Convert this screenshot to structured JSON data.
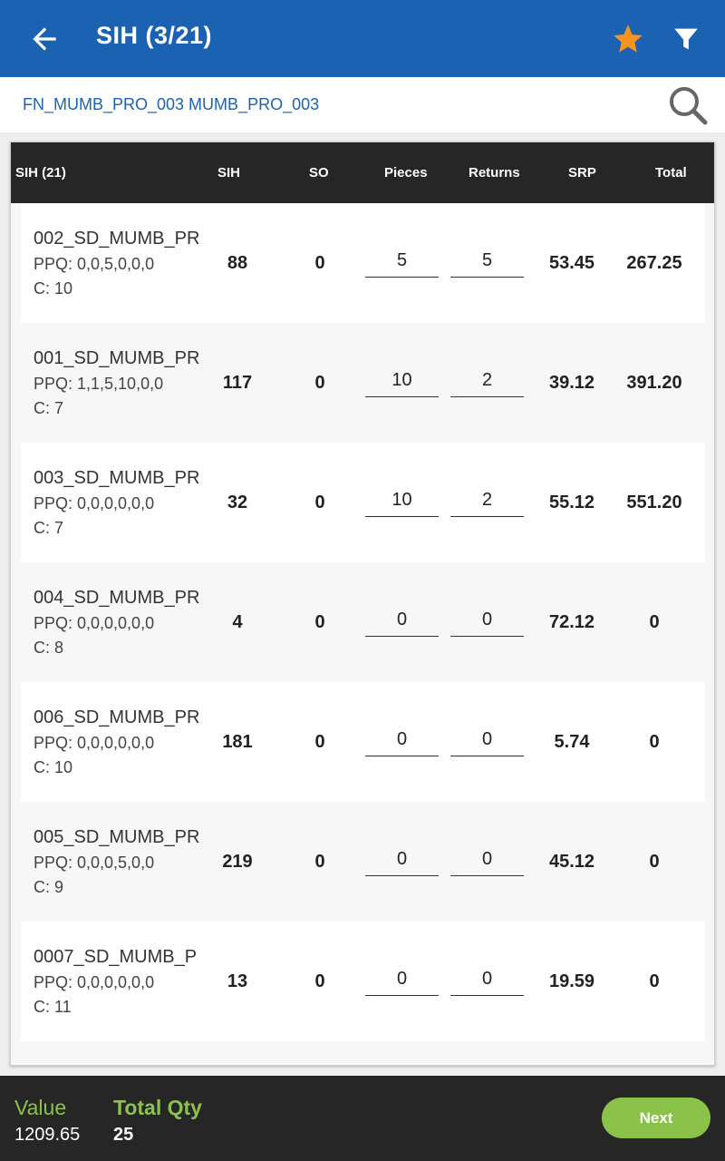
{
  "header": {
    "title": "SIH (3/21)",
    "back_icon": "back-arrow-icon",
    "star_icon": "star-icon",
    "filter_icon": "filter-icon",
    "star_color": "#f7931e",
    "bg_color": "#1b62b3"
  },
  "search": {
    "value": "FN_MUMB_PRO_003 MUMB_PRO_003",
    "icon": "search-icon"
  },
  "table": {
    "columns": [
      "SIH (21)",
      "SIH",
      "SO",
      "Pieces",
      "Returns",
      "SRP",
      "Total"
    ],
    "rows": [
      {
        "name": "002_SD_MUMB_PR",
        "ppq": "PPQ: 0,0,5,0,0,0",
        "c": "C: 10",
        "sih": "88",
        "so": "0",
        "pieces": "5",
        "returns": "5",
        "srp": "53.45",
        "total": "267.25"
      },
      {
        "name": "001_SD_MUMB_PR",
        "ppq": "PPQ: 1,1,5,10,0,0",
        "c": "C: 7",
        "sih": "117",
        "so": "0",
        "pieces": "10",
        "returns": "2",
        "srp": "39.12",
        "total": "391.20"
      },
      {
        "name": "003_SD_MUMB_PR",
        "ppq": "PPQ: 0,0,0,0,0,0",
        "c": "C: 7",
        "sih": "32",
        "so": "0",
        "pieces": "10",
        "returns": "2",
        "srp": "55.12",
        "total": "551.20"
      },
      {
        "name": "004_SD_MUMB_PR",
        "ppq": "PPQ: 0,0,0,0,0,0",
        "c": "C: 8",
        "sih": "4",
        "so": "0",
        "pieces": "0",
        "returns": "0",
        "srp": "72.12",
        "total": "0"
      },
      {
        "name": "006_SD_MUMB_PR",
        "ppq": "PPQ: 0,0,0,0,0,0",
        "c": "C: 10",
        "sih": "181",
        "so": "0",
        "pieces": "0",
        "returns": "0",
        "srp": "5.74",
        "total": "0"
      },
      {
        "name": "005_SD_MUMB_PR",
        "ppq": "PPQ: 0,0,0,5,0,0",
        "c": "C: 9",
        "sih": "219",
        "so": "0",
        "pieces": "0",
        "returns": "0",
        "srp": "45.12",
        "total": "0"
      },
      {
        "name": "0007_SD_MUMB_P",
        "ppq": "PPQ: 0,0,0,0,0,0",
        "c": "C: 11",
        "sih": "13",
        "so": "0",
        "pieces": "0",
        "returns": "0",
        "srp": "19.59",
        "total": "0"
      }
    ]
  },
  "footer": {
    "value_label": "Value",
    "value": "1209.65",
    "qty_label": "Total Qty",
    "qty": "25",
    "next_label": "Next",
    "accent_color": "#8bc34a"
  }
}
